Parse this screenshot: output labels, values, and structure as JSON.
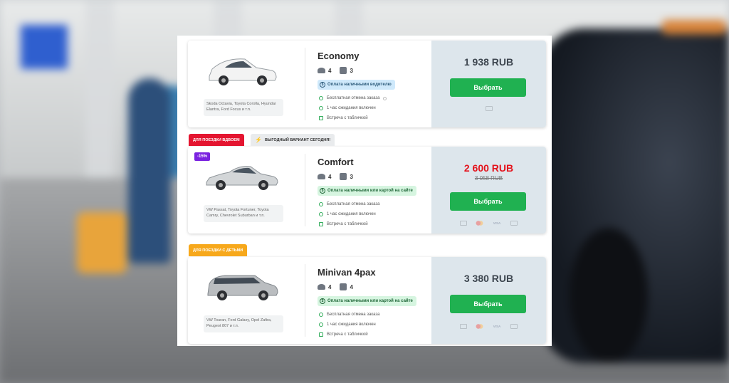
{
  "offers": [
    {
      "title": "Economy",
      "models": "Skoda Octavia, Toyota Corolla, Hyundai Elantra, Ford Focus и т.п.",
      "passengers": "4",
      "bags": "3",
      "payment": "Оплата наличными водителю",
      "payment_style": "blue",
      "features": [
        "Бесплатная отмена заказа",
        "1 час ожидания включен",
        "Встреча с табличкой"
      ],
      "price": "1 938 RUB",
      "button": "Выбрать",
      "car_color": "#f2f2f2"
    },
    {
      "title": "Comfort",
      "models": "VW Passat, Toyota Fortuner, Toyota Camry, Chevrolet Suburban и т.п.",
      "passengers": "4",
      "bags": "3",
      "payment": "Оплата наличными или картой на сайте",
      "payment_style": "green",
      "features": [
        "Бесплатная отмена заказа",
        "1 час ожидания включен",
        "Встреча с табличкой"
      ],
      "price": "2 600 RUB",
      "old_price": "3 058 RUB",
      "discount": "-15%",
      "button": "Выбрать",
      "car_color": "#cfd2d4",
      "payment_icons": [
        "card-icon",
        "mastercard-icon",
        "VISA",
        "mir-icon"
      ]
    },
    {
      "title": "Minivan 4pax",
      "models": "VW Touran, Ford Galaxy, Opel Zafira, Peugeot 807 и т.п.",
      "passengers": "4",
      "bags": "4",
      "payment": "Оплата наличными или картой на сайте",
      "payment_style": "green",
      "features": [
        "Бесплатная отмена заказа",
        "1 час ожидания включен",
        "Встреча с табличкой"
      ],
      "price": "3 380 RUB",
      "button": "Выбрать",
      "car_color": "#b8bbbe",
      "payment_icons": [
        "card-icon",
        "mastercard-icon",
        "VISA",
        "mir-icon"
      ]
    }
  ],
  "tags": {
    "couple": "ДЛЯ ПОЕЗДКИ ВДВОЕМ",
    "best_today": "ВЫГОДНЫЙ ВАРИАНТ СЕГОДНЯ!",
    "kids": "ДЛЯ ПОЕЗДКИ С ДЕТЬМИ"
  },
  "colors": {
    "accent_green": "#20b151",
    "price_red": "#e4131c",
    "discount_purple": "#7a22e0",
    "tag_red": "#e41530",
    "tag_orange": "#f7a81b"
  }
}
